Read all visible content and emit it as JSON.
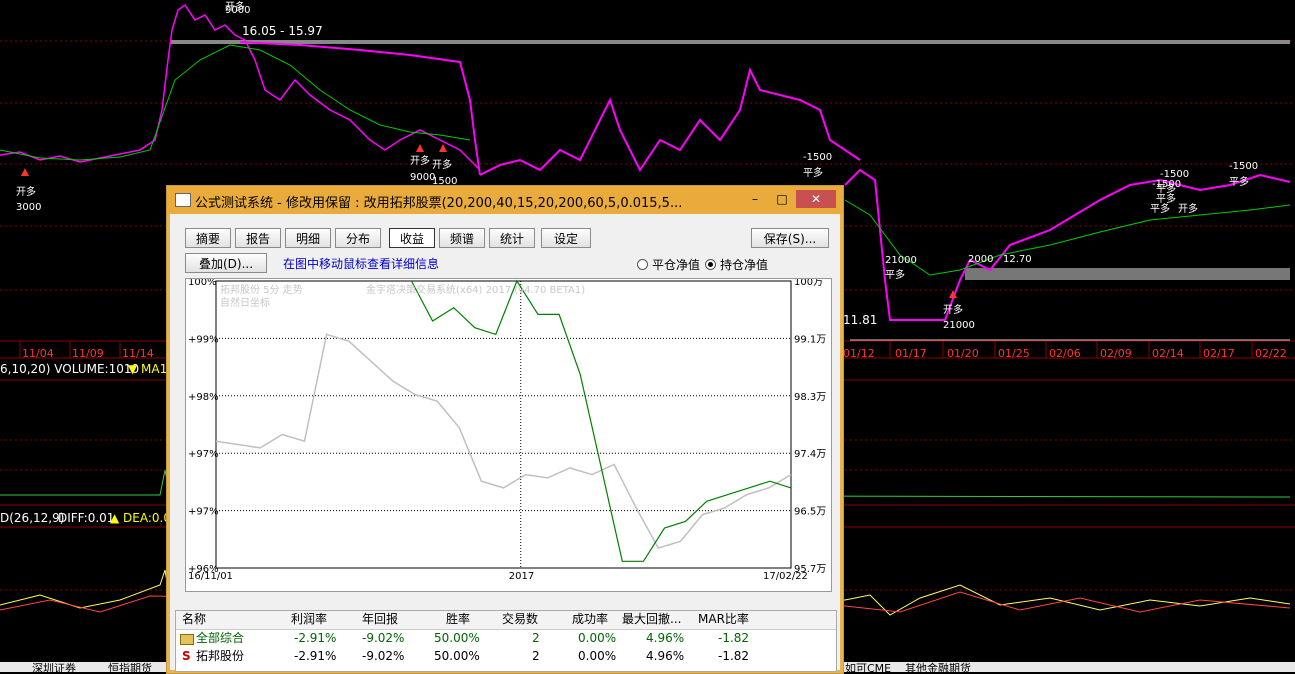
{
  "colors": {
    "price": "#ff00ff",
    "ma": "#00cc00",
    "grid": "#8b0000",
    "axis_text": "#ffffff",
    "dialog_title": "#e9ab3c",
    "gray_series": "#c0c0c0",
    "green_series": "#008000"
  },
  "background": {
    "price_labels": [
      "16.05 - 15.97",
      "11.81"
    ],
    "trade_marks": [
      "开多",
      "开多",
      "开多",
      "开多",
      "平多",
      "平多",
      "平多",
      "平多",
      "开多",
      "开多",
      "平多",
      "平多"
    ],
    "trade_qty": [
      "3000",
      "9000",
      "1500",
      "9000",
      "-1500",
      "21000",
      "21000",
      "-1500",
      "-1500",
      "-1500",
      "12.70",
      "2000"
    ],
    "dates": [
      "11/04",
      "11/09",
      "11/14",
      "01/12",
      "01/17",
      "01/20",
      "01/25",
      "02/06",
      "02/09",
      "02/14",
      "02/17",
      "02/22"
    ],
    "volume_label": "6,10,20) VOLUME:1010",
    "volume_ma": "▼ MA1",
    "macd_label": "D(26,12,9) ",
    "macd_diff": "DIFF:0.01",
    "macd_dea": "▲ DEA:0.0",
    "bottom_tabs": [
      "深圳证券",
      "恒指期货",
      "如可CME",
      "其他金融期货"
    ]
  },
  "dialog": {
    "title": "公式测试系统 - 修改用保留 : 改用拓邦股票(20,200,40,15,20,200,60,5,0.015,5...",
    "controls": {
      "minimize": "–",
      "maximize": "□",
      "close": "✕"
    },
    "tabs": [
      "摘要",
      "报告",
      "明细",
      "分布",
      "收益",
      "频谱",
      "统计",
      "设定"
    ],
    "selected_tab": "收益",
    "save_button": "保存(S)...",
    "overlay_button": "叠加(D)...",
    "hint": "在图中移动鼠标查看详细信息",
    "radios": [
      {
        "label": "平仓净值",
        "checked": false
      },
      {
        "label": "持仓净值",
        "checked": true
      }
    ],
    "chart_overlay": {
      "line1": "拓邦股份 5分 走势",
      "line2": "自然日坐标",
      "line3": "金字塔决策交易系统(x64) 2017 (v4.70 BETA1)"
    },
    "table": {
      "headers": [
        "名称",
        "利润率",
        "年回报",
        "胜率",
        "交易数",
        "成功率",
        "最大回撤...",
        "MAR比率"
      ],
      "rows": [
        {
          "icon": "folder-icon",
          "name": "全部综合",
          "profit": "-2.91%",
          "annual": "-9.02%",
          "win": "50.00%",
          "trades": "2",
          "success": "0.00%",
          "drawdown": "4.96%",
          "mar": "-1.82"
        },
        {
          "icon": "S",
          "name": "拓邦股份",
          "profit": "-2.91%",
          "annual": "-9.02%",
          "win": "50.00%",
          "trades": "2",
          "success": "0.00%",
          "drawdown": "4.96%",
          "mar": "-1.82"
        }
      ]
    }
  },
  "chart_data": {
    "type": "line",
    "x_labels": [
      "16/11/01",
      "2017",
      "17/02/22"
    ],
    "y_left_ticks": [
      "100%",
      "+99%",
      "+98%",
      "+97%",
      "+97%",
      "+96%"
    ],
    "y_right_ticks": [
      "100万",
      "99.1万",
      "98.3万",
      "97.4万",
      "96.5万",
      "95.7万"
    ],
    "ylim_left": [
      95.7,
      100
    ],
    "ylim_right": [
      95.7,
      100
    ],
    "grid": true,
    "series": [
      {
        "color": "#c0c0c0",
        "values": [
          97.6,
          97.55,
          97.5,
          97.7,
          97.6,
          99.2,
          99.1,
          98.8,
          98.5,
          98.3,
          98.2,
          97.8,
          97.0,
          96.9,
          97.1,
          97.05,
          97.2,
          97.1,
          97.25,
          96.6,
          96.0,
          96.1,
          96.5,
          96.6,
          96.8,
          96.9,
          97.1
        ]
      },
      {
        "color": "#008000",
        "values": [
          100,
          99.4,
          99.6,
          99.3,
          99.2,
          100,
          99.5,
          99.5,
          98.6,
          97.2,
          95.8,
          95.8,
          96.3,
          96.4,
          96.7,
          96.8,
          96.9,
          97.0,
          96.9
        ]
      }
    ]
  }
}
